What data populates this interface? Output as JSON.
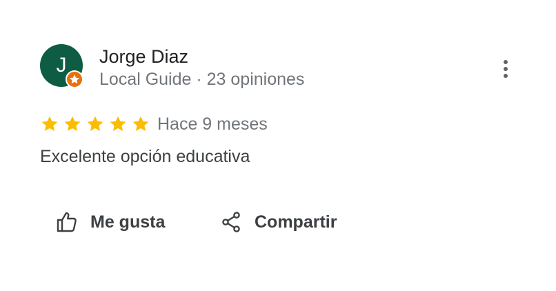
{
  "review": {
    "author": {
      "avatar_initial": "J",
      "avatar_color": "#0f5c45",
      "badge_color": "#e8710a",
      "badge_icon": "local-guide-star-icon",
      "name": "Jorge Diaz",
      "meta": "Local Guide · 23 opiniones"
    },
    "menu_icon": "more-vert-icon",
    "rating": {
      "stars_filled": 5,
      "stars_total": 5,
      "star_color": "#fbbc04"
    },
    "date": "Hace 9 meses",
    "text": "Excelente opción educativa",
    "actions": {
      "like": {
        "label": "Me gusta",
        "icon": "thumbs-up-icon"
      },
      "share": {
        "label": "Compartir",
        "icon": "share-icon"
      }
    }
  }
}
